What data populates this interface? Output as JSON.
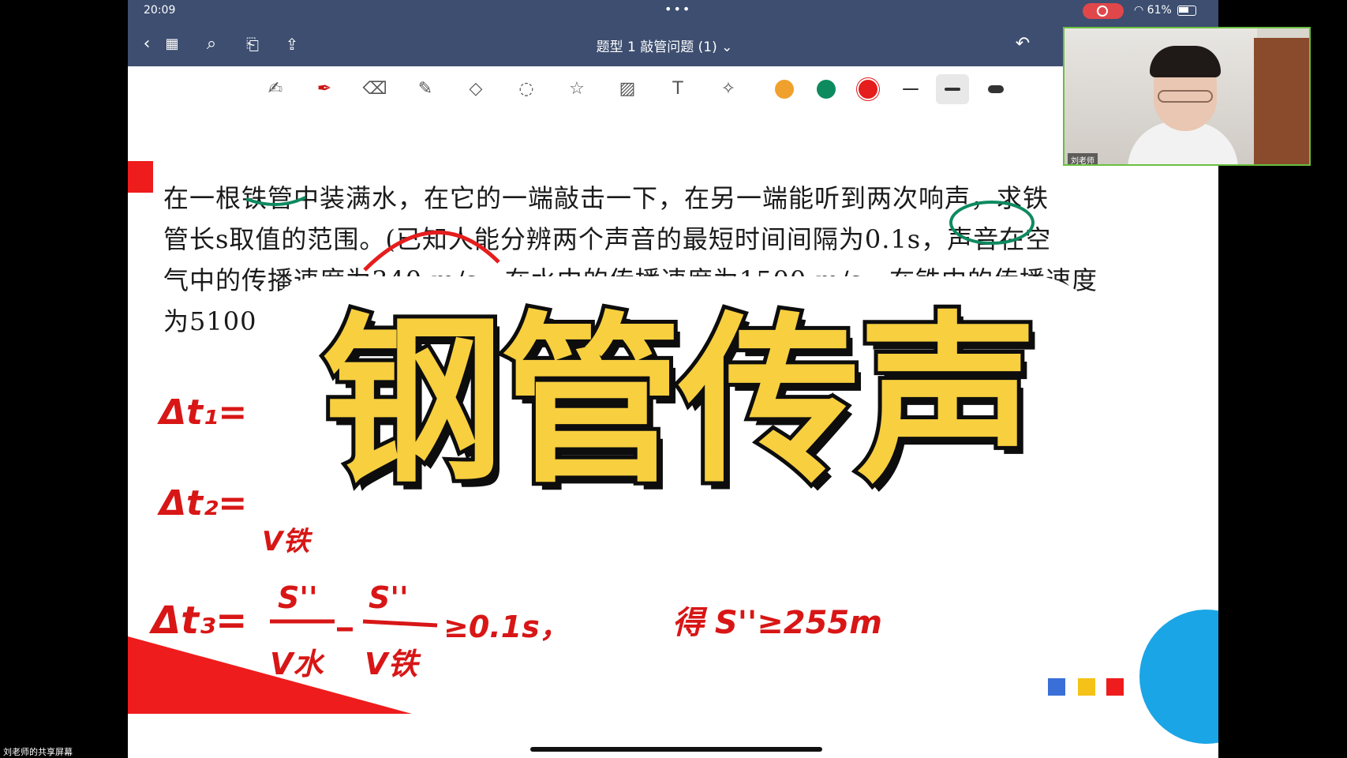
{
  "status": {
    "time": "20:09",
    "battery": "61%"
  },
  "nav": {
    "title": "题型 1 敲管问题 (1)",
    "title_chevron": "⌄"
  },
  "toolbar": {
    "colors": [
      "#f0a02c",
      "#0e8a5f",
      "#e51d1d"
    ],
    "tools": [
      "zoom-write",
      "pen",
      "eraser",
      "highlighter",
      "shapes",
      "lasso",
      "sticker",
      "image",
      "text",
      "laser"
    ]
  },
  "problem": {
    "line1": "在一根铁管中装满水，在它的一端敲击一下，在另一端能听到两次响声，求铁",
    "line2": "管长s取值的范围。(已知人能分辨两个声音的最短时间间隔为0.1s，声音在空",
    "line3": "气中的传播速度为340 m/s，在水中的传播速度为1500 m/s，在铁中的传播速度",
    "line4": "为5100 m/s)"
  },
  "ink": {
    "eq1": "Δt₁=",
    "eq2": "Δt₂=",
    "eq3": "Δt₃=",
    "frac1_num": "S''",
    "frac1_den": "V水",
    "frac2_num": "S''",
    "frac2_den": "V铁",
    "cond": "≥0.1s，",
    "result": "得 S''≥255m",
    "partial_den": "V铁"
  },
  "overlay_title": "钢管传声",
  "pip": {
    "name": "刘老师"
  },
  "share_label": "刘老师的共享屏幕"
}
